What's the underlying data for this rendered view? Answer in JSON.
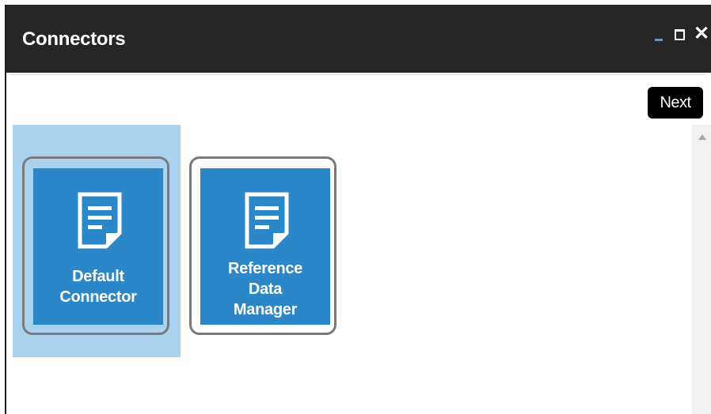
{
  "window": {
    "title": "Connectors",
    "controls": {
      "minimize_icon": "minimize-icon",
      "maximize_icon": "maximize-icon",
      "close_glyph": "✕"
    }
  },
  "toolbar": {
    "next_label": "Next"
  },
  "tiles": [
    {
      "line1": "Default",
      "line2": "Connector",
      "line3": "",
      "icon": "document-icon",
      "selected": true
    },
    {
      "line1": "Reference",
      "line2": "Data",
      "line3": "Manager",
      "icon": "document-icon",
      "selected": false
    }
  ],
  "colors": {
    "titlebar": "#262626",
    "tile_blue": "#2b87c7",
    "selection_highlight": "#a9d2ef",
    "accent_minimize": "#4aa3e0"
  }
}
